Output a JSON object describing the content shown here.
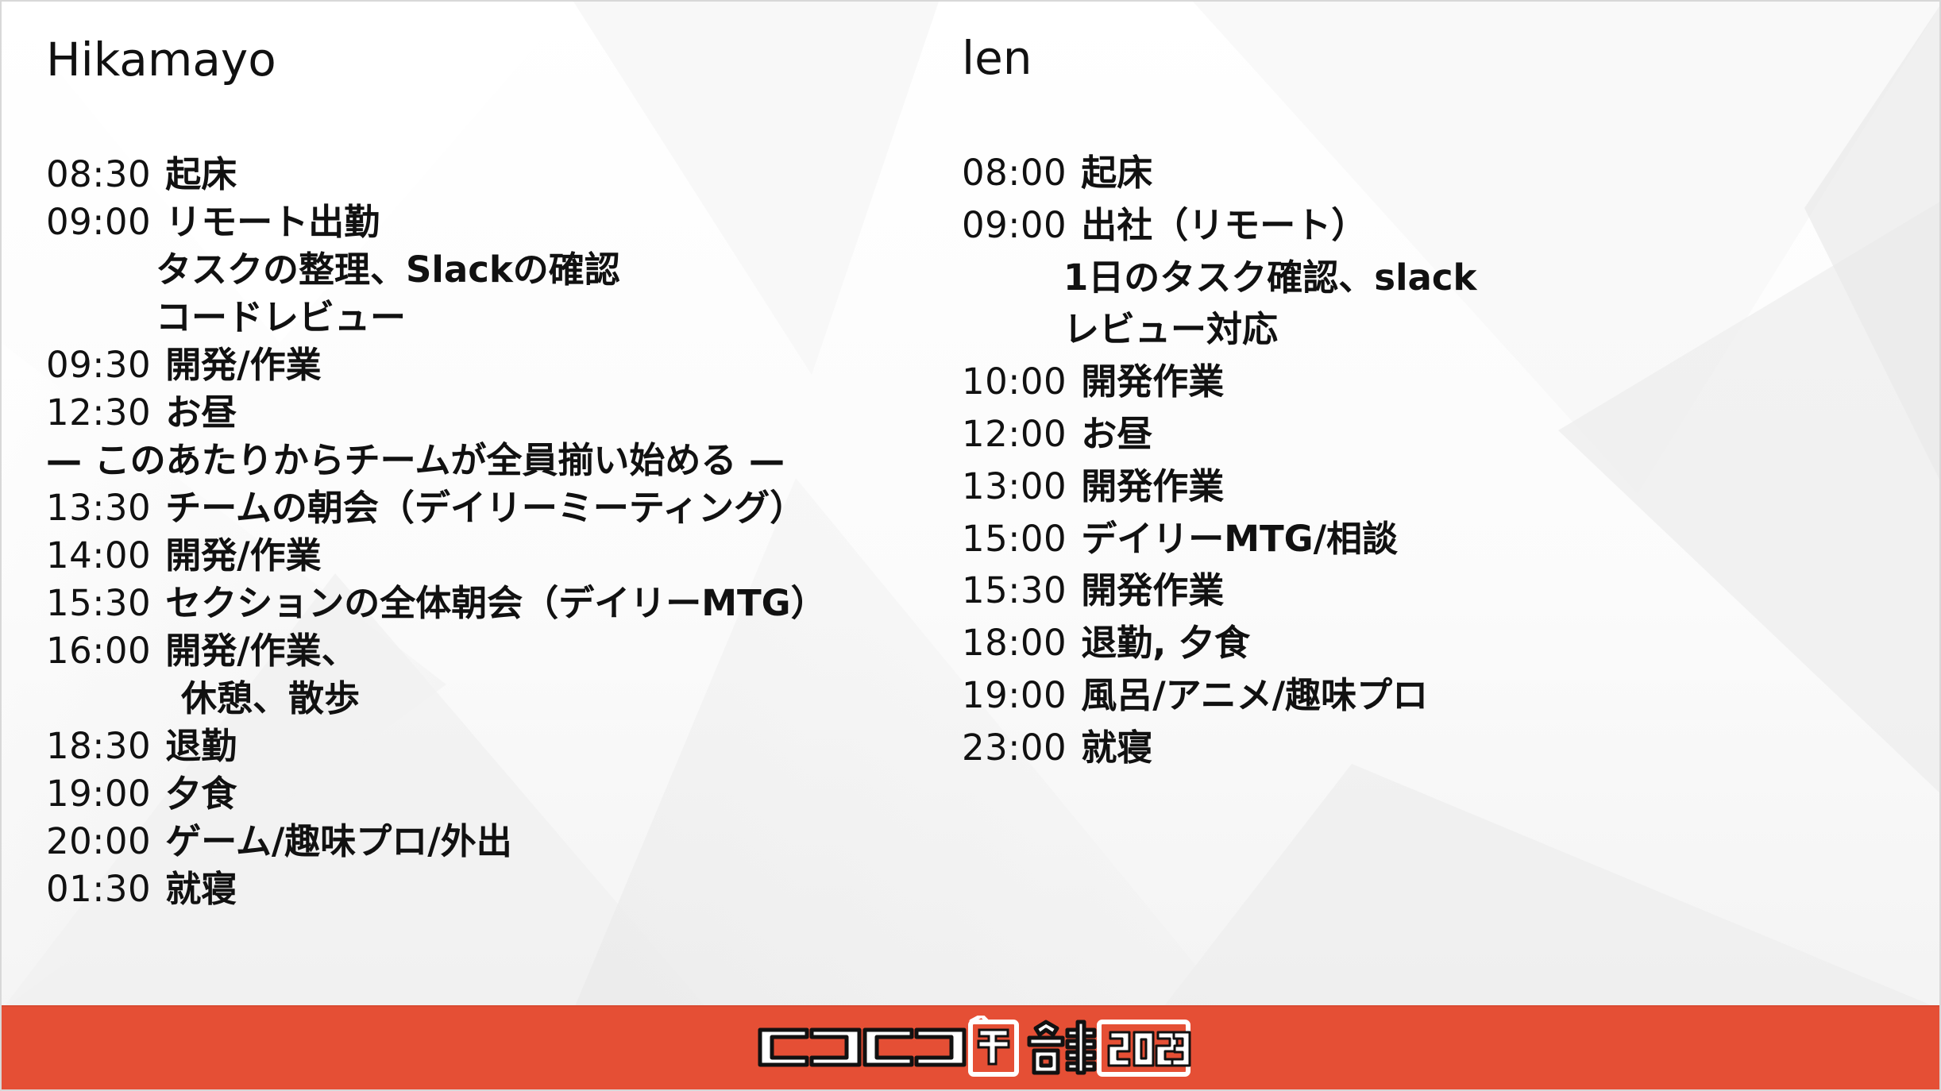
{
  "slide": {
    "left_person": {
      "name": "Hikamayo",
      "entries": [
        {
          "time": "08:30",
          "text": "起床"
        },
        {
          "time": "09:00",
          "text": "リモート出勤"
        },
        {
          "time": "",
          "text": "タスクの整理、Slackの確認"
        },
        {
          "time": "",
          "text": "コードレビュー"
        },
        {
          "time": "09:30",
          "text": "開発/作業"
        },
        {
          "time": "12:30",
          "text": "お昼"
        },
        {
          "time": "",
          "text": "— このあたりからチームが全員揃い始める —"
        },
        {
          "time": "13:30",
          "text": "チームの朝会（デイリーミーティング）"
        },
        {
          "time": "14:00",
          "text": "開発/作業"
        },
        {
          "time": "15:30",
          "text": "セクションの全体朝会（デイリーMTG）"
        },
        {
          "time": "16:00",
          "text": "開発/作業、"
        },
        {
          "time": "",
          "text": "休憩、散歩"
        },
        {
          "time": "18:30",
          "text": "退勤"
        },
        {
          "time": "19:00",
          "text": "夕食"
        },
        {
          "time": "20:00",
          "text": "ゲーム/趣味プロ/外出"
        },
        {
          "time": "01:30",
          "text": "就寝"
        }
      ]
    },
    "right_person": {
      "name": "len",
      "entries": [
        {
          "time": "08:00",
          "text": "起床"
        },
        {
          "time": "09:00",
          "text": "出社（リモート）"
        },
        {
          "time": "",
          "text": "1日のタスク確認、slack"
        },
        {
          "time": "",
          "text": "レビュー対応"
        },
        {
          "time": "10:00",
          "text": "開発作業"
        },
        {
          "time": "12:00",
          "text": "お昼"
        },
        {
          "time": "13:00",
          "text": "開発作業"
        },
        {
          "time": "15:00",
          "text": "デイリーMTG/相談"
        },
        {
          "time": "15:30",
          "text": "開発作業"
        },
        {
          "time": "18:00",
          "text": "退勤, 夕食"
        },
        {
          "time": "19:00",
          "text": "風呂/アニメ/趣味プロ"
        },
        {
          "time": "23:00",
          "text": "就寝"
        }
      ]
    },
    "footer_logo": {
      "text": "ニコニコ超会議2023",
      "brand_parts": [
        "ニコニコ",
        "超",
        "会議",
        "2023"
      ]
    }
  },
  "colors": {
    "footer_bar": "#e54f35",
    "text": "#111111",
    "background": "#f7f7f7"
  }
}
